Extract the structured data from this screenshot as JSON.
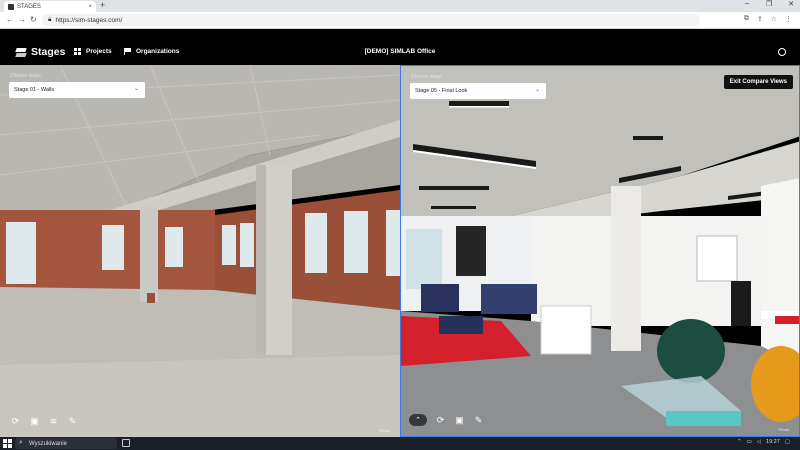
{
  "browser": {
    "tab_title": "STAGES",
    "tab_close": "×",
    "new_tab": "+",
    "url": "https://sim-stages.com/",
    "window_controls": [
      "–",
      "❐",
      "✕"
    ],
    "nav": {
      "back": "←",
      "forward": "→",
      "reload": "↻"
    }
  },
  "header": {
    "logo_text": "Stages",
    "nav_projects": "Projects",
    "nav_organizations": "Organizations",
    "title": "[DEMO] SIMLAB Office"
  },
  "left_viewer": {
    "stage_label": "Choose stage",
    "selected_stage": "Stage 01 - Walls",
    "credit": "Photo"
  },
  "right_viewer": {
    "stage_label": "Choose stage",
    "selected_stage": "Stage 05 - Final Look",
    "exit_button": "Exit Compare Views",
    "credit": "Photo"
  },
  "taskbar": {
    "search_placeholder": "Wyszukiwanie",
    "time": "19:27"
  },
  "colors": {
    "accent_border": "#3b7be8",
    "header_bg": "#000000",
    "taskbar_bg": "#1b1f27"
  }
}
